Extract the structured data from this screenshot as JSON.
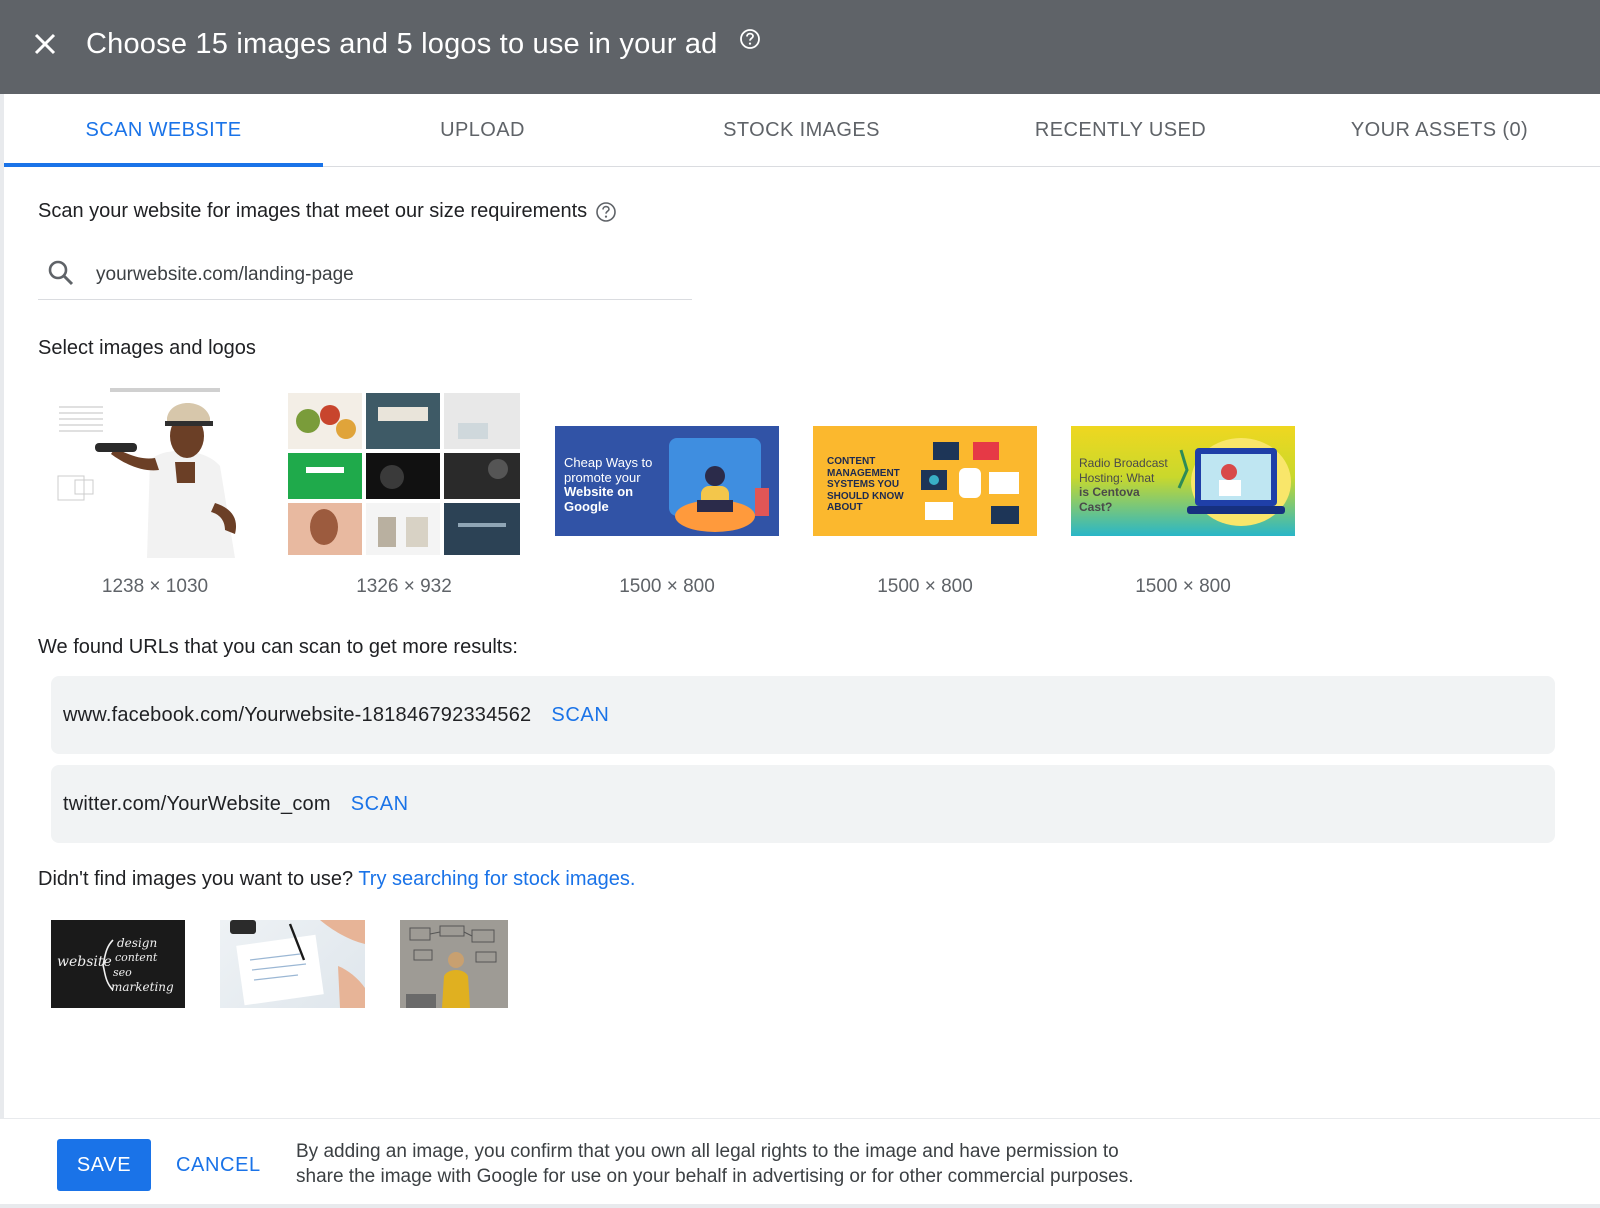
{
  "header": {
    "title": "Choose 15 images and 5 logos to use in your ad",
    "close_icon": "close-icon",
    "help_icon": "help-circle-icon"
  },
  "tabs": [
    {
      "label": "SCAN WEBSITE",
      "active": true
    },
    {
      "label": "UPLOAD",
      "active": false
    },
    {
      "label": "STOCK IMAGES",
      "active": false
    },
    {
      "label": "RECENTLY USED",
      "active": false
    },
    {
      "label": "YOUR ASSETS (0)",
      "active": false
    }
  ],
  "scan": {
    "label": "Scan your website for images that meet our size requirements",
    "search_value": "yourwebsite.com/landing-page"
  },
  "select_label": "Select images and logos",
  "images": [
    {
      "caption": "1238 × 1030"
    },
    {
      "caption": "1326 × 932"
    },
    {
      "caption": "1500 × 800",
      "text": [
        "Cheap Ways to",
        "promote your",
        "Website on",
        "Google"
      ]
    },
    {
      "caption": "1500 × 800",
      "text": [
        "CONTENT",
        "MANAGEMENT",
        "SYSTEMS YOU",
        "SHOULD KNOW",
        "ABOUT"
      ]
    },
    {
      "caption": "1500 × 800",
      "text": [
        "Radio Broadcast",
        "Hosting: What",
        "is Centova",
        "Cast?"
      ]
    }
  ],
  "found": {
    "label": "We found URLs that you can scan to get more results:",
    "urls": [
      {
        "url": "www.facebook.com/Yourwebsite-181846792334562",
        "action": "SCAN"
      },
      {
        "url": "twitter.com/YourWebsite_com",
        "action": "SCAN"
      }
    ]
  },
  "stock": {
    "prompt": "Didn't find images you want to use?",
    "link": "Try searching for stock images.",
    "chalk_words": [
      "website",
      "design",
      "content",
      "seo",
      "marketing"
    ]
  },
  "footer": {
    "save": "SAVE",
    "cancel": "CANCEL",
    "disclaimer_line1": "By adding an image, you confirm that you own all legal rights to the image and have permission to",
    "disclaimer_line2": "share the image with Google for use on your behalf in advertising or for other commercial purposes."
  },
  "colors": {
    "header_bg": "#5f6368",
    "accent": "#1a73e8",
    "row_bg": "#f1f3f4"
  }
}
